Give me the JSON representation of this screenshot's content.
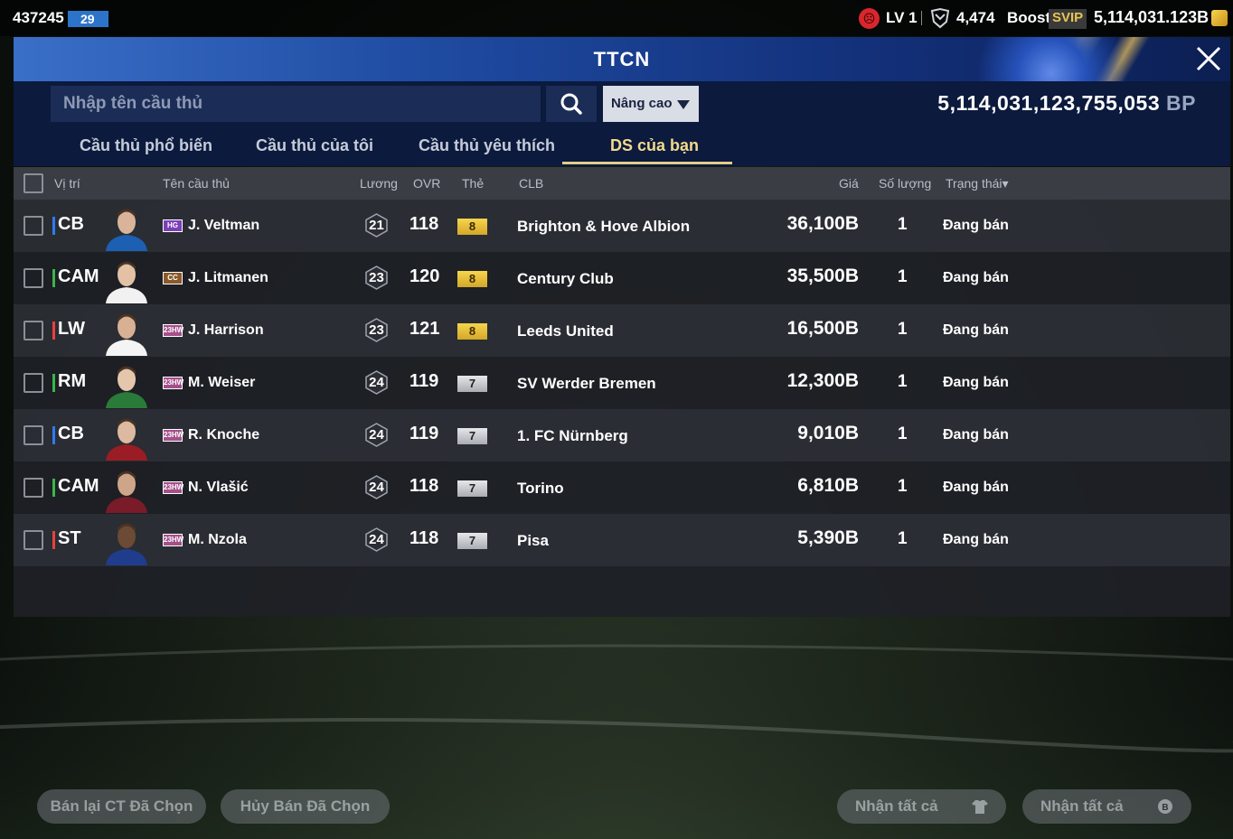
{
  "topbar": {
    "user_id": "437245",
    "badge": "29",
    "level": "LV 1",
    "coins": "4,474",
    "boost": "Boost",
    "svip": "SVIP",
    "bp": "5,114,031.123B"
  },
  "header": {
    "title": "TTCN"
  },
  "search": {
    "placeholder": "Nhập tên cầu thủ",
    "advanced": "Nâng cao",
    "bp_amount": "5,114,031,123,755,053",
    "bp_unit": "BP"
  },
  "tabs": [
    {
      "label": "Cầu thủ phổ biến"
    },
    {
      "label": "Cầu thủ của tôi"
    },
    {
      "label": "Cầu thủ yêu thích"
    },
    {
      "label": "DS của bạn"
    }
  ],
  "columns": {
    "position": "Vị trí",
    "name": "Tên cầu thủ",
    "wage": "Lương",
    "ovr": "OVR",
    "card": "Thẻ",
    "club": "CLB",
    "price": "Giá",
    "quantity": "Số lượng",
    "status": "Trạng thái"
  },
  "rows": [
    {
      "position": "CB",
      "pos_color": "#2f7bf0",
      "season": "HG",
      "season_color": "#7b3fb8",
      "name": "J. Veltman",
      "wage": "21",
      "ovr": "118",
      "card": "8",
      "card_type": "gold",
      "club": "Brighton & Hove Albion",
      "price": "36,100B",
      "qty": "1",
      "status": "Đang bán"
    },
    {
      "position": "CAM",
      "pos_color": "#3bb54a",
      "season": "CC",
      "season_color": "#8a5a2b",
      "name": "J. Litmanen",
      "wage": "23",
      "ovr": "120",
      "card": "8",
      "card_type": "gold",
      "club": "Century Club",
      "price": "35,500B",
      "qty": "1",
      "status": "Đang bán"
    },
    {
      "position": "LW",
      "pos_color": "#e8413c",
      "season": "23HW",
      "season_color": "#a4508a",
      "name": "J. Harrison",
      "wage": "23",
      "ovr": "121",
      "card": "8",
      "card_type": "gold",
      "club": "Leeds United",
      "price": "16,500B",
      "qty": "1",
      "status": "Đang bán"
    },
    {
      "position": "RM",
      "pos_color": "#3bb54a",
      "season": "23HW",
      "season_color": "#a4508a",
      "name": "M. Weiser",
      "wage": "24",
      "ovr": "119",
      "card": "7",
      "card_type": "silver",
      "club": "SV Werder Bremen",
      "price": "12,300B",
      "qty": "1",
      "status": "Đang bán"
    },
    {
      "position": "CB",
      "pos_color": "#2f7bf0",
      "season": "23HW",
      "season_color": "#a4508a",
      "name": "R. Knoche",
      "wage": "24",
      "ovr": "119",
      "card": "7",
      "card_type": "silver",
      "club": "1. FC Nürnberg",
      "price": "9,010B",
      "qty": "1",
      "status": "Đang bán"
    },
    {
      "position": "CAM",
      "pos_color": "#3bb54a",
      "season": "23HW",
      "season_color": "#a4508a",
      "name": "N. Vlašić",
      "wage": "24",
      "ovr": "118",
      "card": "7",
      "card_type": "silver",
      "club": "Torino",
      "price": "6,810B",
      "qty": "1",
      "status": "Đang bán"
    },
    {
      "position": "ST",
      "pos_color": "#e8413c",
      "season": "23HW",
      "season_color": "#a4508a",
      "name": "M. Nzola",
      "wage": "24",
      "ovr": "118",
      "card": "7",
      "card_type": "silver",
      "club": "Pisa",
      "price": "5,390B",
      "qty": "1",
      "status": "Đang bán"
    }
  ],
  "bottom": {
    "resell": "Bán lại CT Đã Chọn",
    "cancel": "Hủy Bán Đã Chọn",
    "claim_players": "Nhận tất cả",
    "claim_bp": "Nhận tất cả"
  }
}
